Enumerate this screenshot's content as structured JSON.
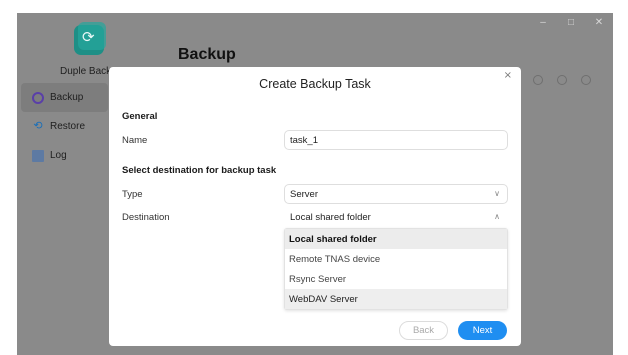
{
  "app": {
    "name": "Duple Backup",
    "page_title": "Backup",
    "window_controls": [
      "–",
      "□",
      "✕"
    ]
  },
  "sidebar": {
    "items": [
      {
        "label": "Backup",
        "icon": "backup-icon",
        "active": true
      },
      {
        "label": "Restore",
        "icon": "restore-icon",
        "active": false
      },
      {
        "label": "Log",
        "icon": "log-icon",
        "active": false
      }
    ]
  },
  "dialog": {
    "title": "Create Backup Task",
    "close": "×",
    "general_section": "General",
    "name_label": "Name",
    "name_value": "task_1",
    "destination_section": "Select destination for backup task",
    "type_label": "Type",
    "type_value": "Server",
    "destination_label": "Destination",
    "destination_value": "Local shared folder",
    "destination_options": [
      "Local shared folder",
      "Remote TNAS device",
      "Rsync Server",
      "WebDAV Server"
    ],
    "back_label": "Back",
    "next_label": "Next"
  },
  "colors": {
    "accent": "#1f8ef1",
    "teal_logo": "#1e8f86",
    "overlay": "#8a8a8a"
  }
}
